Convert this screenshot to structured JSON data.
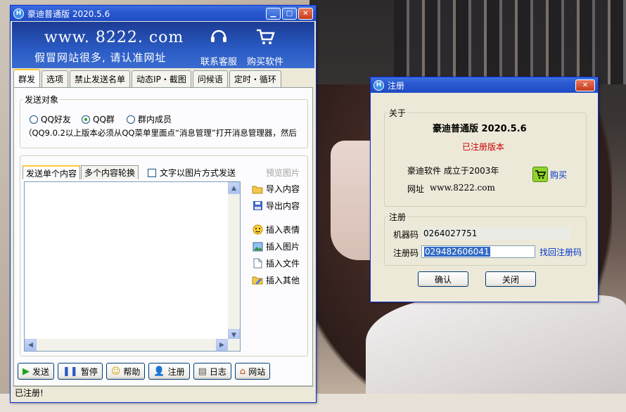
{
  "main_window": {
    "title": "豪迪普通版 2020.5.6",
    "title_buttons": {
      "minimize": "▁",
      "maximize": "□",
      "close": "✕"
    },
    "banner": {
      "url": "www. 8222. com",
      "slogan": "假冒网站很多, 请认准网址",
      "service_label": "联系客服",
      "buy_label": "购买软件"
    },
    "tabs": [
      "群发",
      "选项",
      "禁止发送名单",
      "动态IP・截图",
      "问候语",
      "定时・循环"
    ],
    "active_tab": "群发",
    "send_target": {
      "legend": "发送对象",
      "options": [
        "QQ好友",
        "QQ群",
        "群内成员"
      ],
      "selected": "QQ群",
      "note": "（QQ9.0.2以上版本必须从QQ菜单里面点“消息管理”打开消息管理器，然后"
    },
    "content_tabs": [
      "发送单个内容",
      "多个内容轮换"
    ],
    "image_checkbox_label": "文字以图片方式发送",
    "preview_label": "预览图片",
    "side_actions": {
      "import": "导入内容",
      "export": "导出内容",
      "emoji": "插入表情",
      "image": "插入图片",
      "file": "插入文件",
      "other": "插入其他"
    },
    "bottom_buttons": {
      "send": "发送",
      "pause": "暂停",
      "help": "帮助",
      "register": "注册",
      "log": "日志",
      "site": "网站"
    },
    "status": "已注册!"
  },
  "register_dialog": {
    "title": "注册",
    "close": "✕",
    "about_legend": "关于",
    "product": "豪迪普通版  2020.5.6",
    "registered": "已注册版本",
    "company": "豪迪软件   成立于2003年",
    "website_prefix": "网址",
    "website": "www.8222.com",
    "buy_label": "购买",
    "register_legend": "注册",
    "machine_code_label": "机器码",
    "machine_code": "0264027751",
    "reg_code_label": "注册码",
    "reg_code": "029482606041",
    "recover_label": "找回注册码",
    "ok_label": "确认",
    "close_label": "关闭"
  },
  "colors": {
    "titlebar": "#2a58d0",
    "banner": "#2a5bc4",
    "registered_red": "#cc0000",
    "link_blue": "#0033cc",
    "selection": "#316ac5"
  }
}
